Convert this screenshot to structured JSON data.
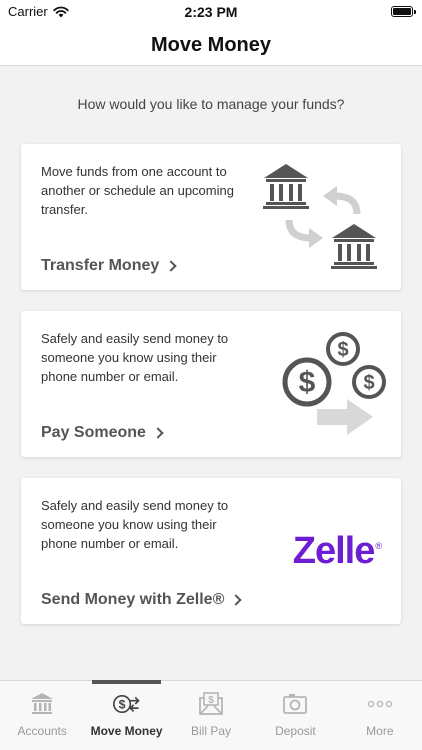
{
  "status": {
    "carrier": "Carrier",
    "time": "2:23 PM"
  },
  "header": {
    "title": "Move Money"
  },
  "prompt": "How would you like to manage your funds?",
  "cards": [
    {
      "description": "Move funds from one account to another or schedule an upcoming transfer.",
      "action": "Transfer Money",
      "icon": "bank-transfer-icon"
    },
    {
      "description": "Safely and easily send money to someone you know using their phone number or email.",
      "action": "Pay Someone",
      "icon": "coins-send-icon"
    },
    {
      "description": "Safely and easily send money to someone you know using their phone number or email.",
      "action": "Send Money with Zelle®",
      "logo_text": "Zelle",
      "logo_mark": "®",
      "logo_color": "#6d1ed4"
    }
  ],
  "tabs": [
    {
      "label": "Accounts",
      "icon": "bank-icon"
    },
    {
      "label": "Move Money",
      "icon": "dollar-transfer-icon",
      "active": true
    },
    {
      "label": "Bill Pay",
      "icon": "envelope-dollar-icon"
    },
    {
      "label": "Deposit",
      "icon": "camera-icon"
    },
    {
      "label": "More",
      "icon": "ellipsis-icon"
    }
  ]
}
